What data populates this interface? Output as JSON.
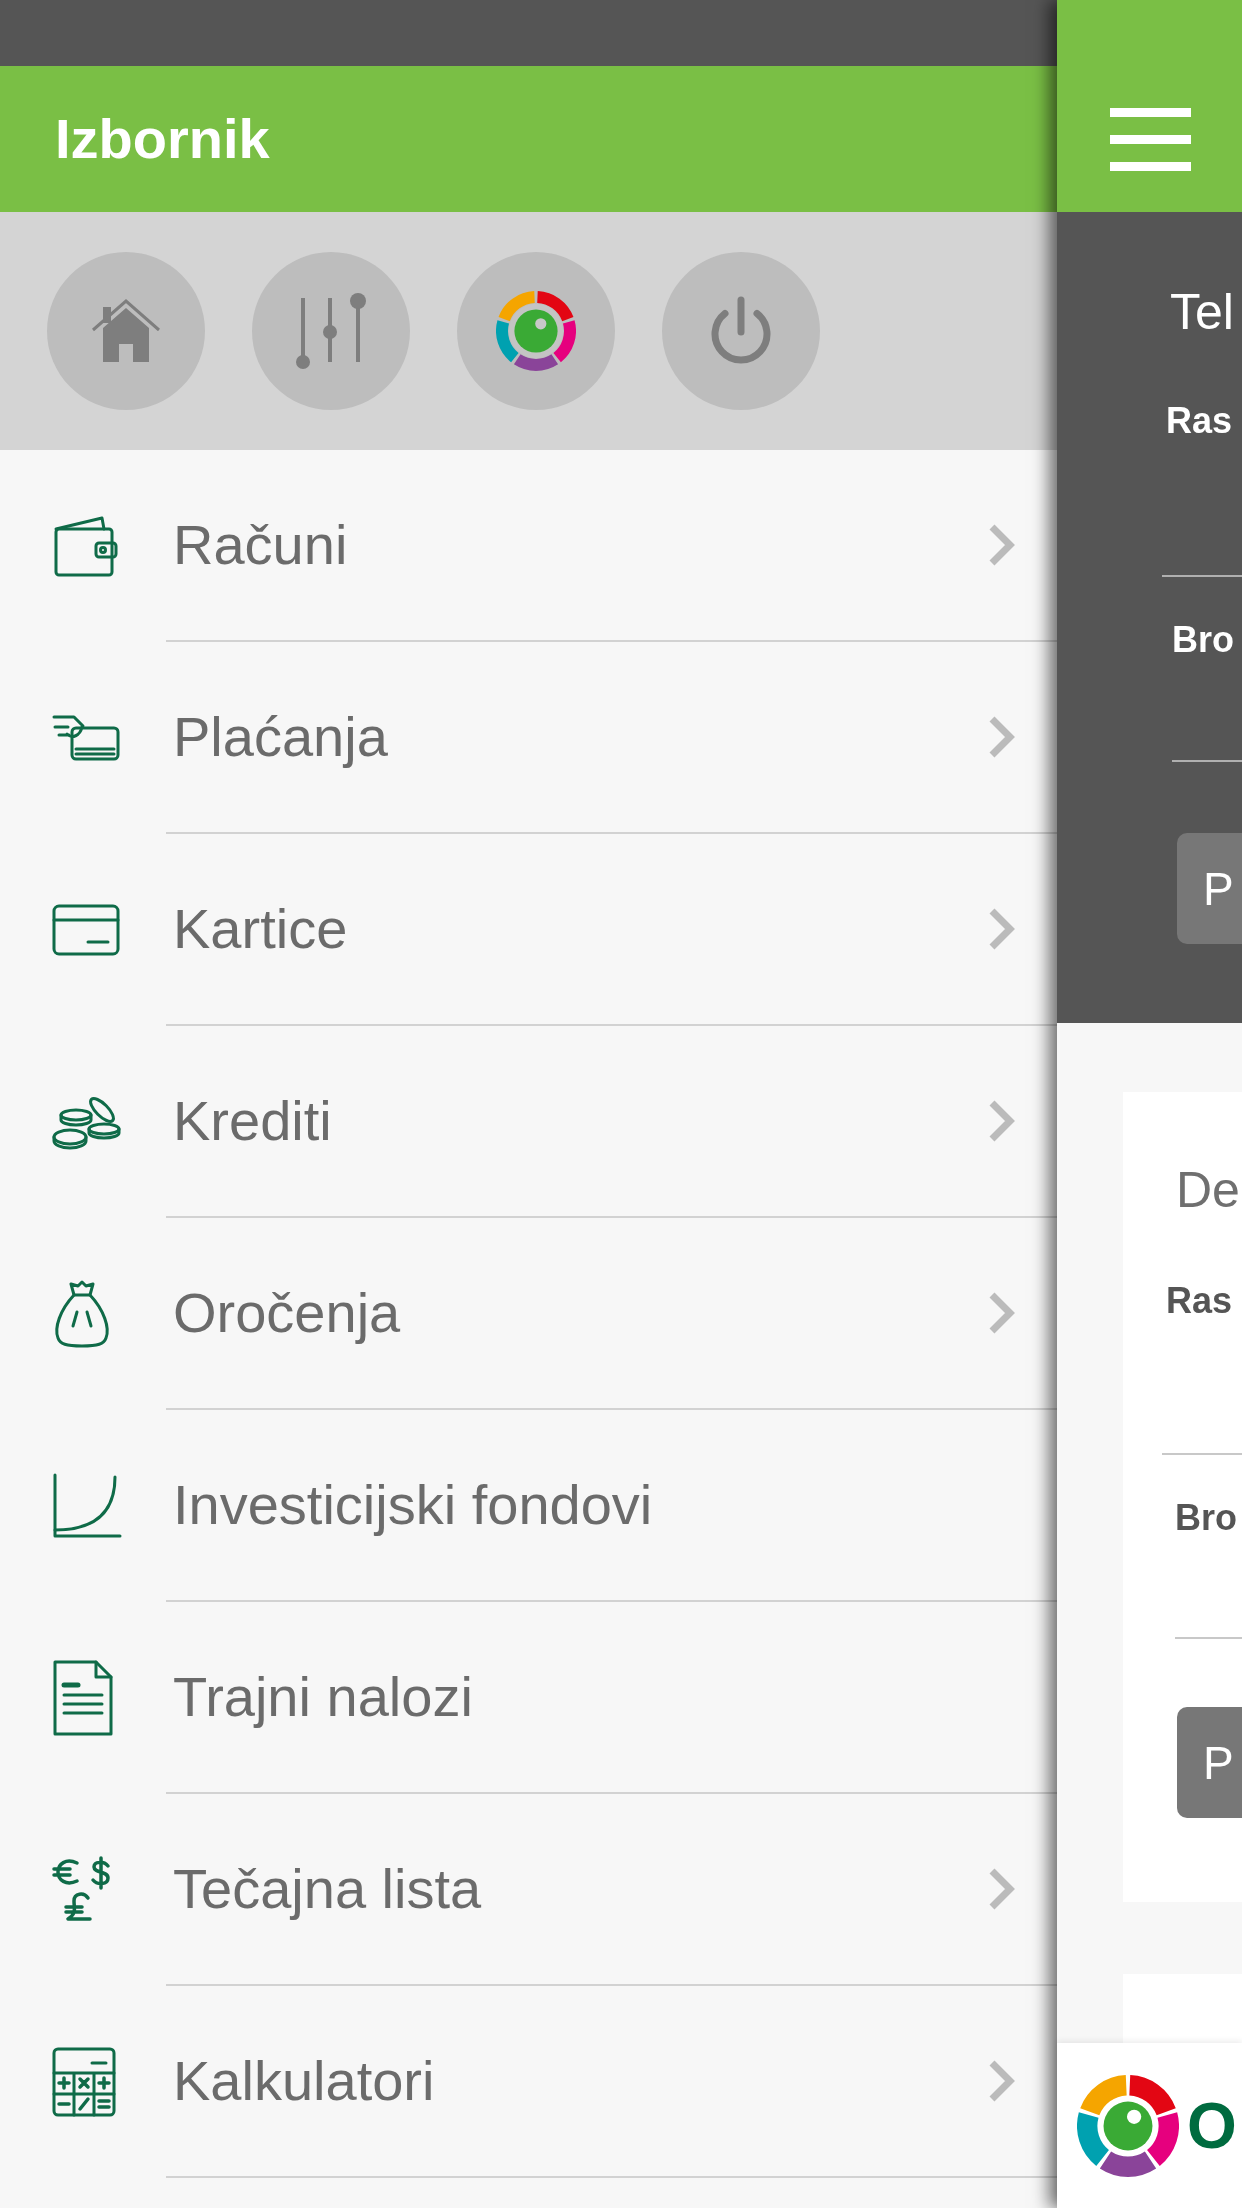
{
  "drawer": {
    "title": "Izbornik",
    "menu_items": [
      {
        "label": "Računi",
        "has_submenu": true
      },
      {
        "label": "Plaćanja",
        "has_submenu": true
      },
      {
        "label": "Kartice",
        "has_submenu": true
      },
      {
        "label": "Krediti",
        "has_submenu": true
      },
      {
        "label": "Oročenja",
        "has_submenu": true
      },
      {
        "label": "Investicijski fondovi",
        "has_submenu": false
      },
      {
        "label": "Trajni nalozi",
        "has_submenu": false
      },
      {
        "label": "Tečajna lista",
        "has_submenu": true
      },
      {
        "label": "Kalkulatori",
        "has_submenu": true
      }
    ]
  },
  "main_page": {
    "summary": {
      "heading": "Tel",
      "line_1": "Ras",
      "line_2": "Bro",
      "button": "P"
    },
    "cards": [
      {
        "heading": "De",
        "line_1": "Ras",
        "line_2": "Bro",
        "button": "P"
      }
    ],
    "footer": {
      "brand": "O"
    }
  }
}
